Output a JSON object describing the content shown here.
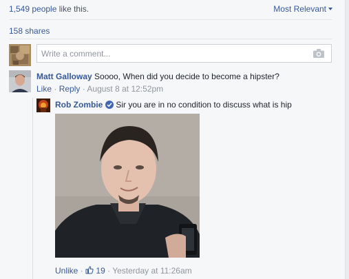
{
  "reactions": {
    "count_text": "1,549 people",
    "suffix": " like this."
  },
  "sort": {
    "label": "Most Relevant"
  },
  "shares": {
    "text": "158 shares"
  },
  "composer": {
    "placeholder": "Write a comment..."
  },
  "comments": [
    {
      "author": "Matt Galloway",
      "text": "Soooo, When did you decide to become a hipster?",
      "like_label": "Like",
      "reply_label": "Reply",
      "time": "August 8 at 12:52pm"
    }
  ],
  "reply": {
    "author": "Rob Zombie",
    "text": "Sir you are in no condition to discuss what is hip",
    "unlike_label": "Unlike",
    "like_count": "19",
    "time": "Yesterday at 11:26am"
  },
  "icons": [
    "camera-icon",
    "verified-badge-icon",
    "thumbs-up-icon",
    "chevron-down-icon"
  ],
  "colors": {
    "link": "#365899",
    "meta": "#90949c",
    "verified": "#4267b2",
    "background": "#f6f7f9"
  }
}
